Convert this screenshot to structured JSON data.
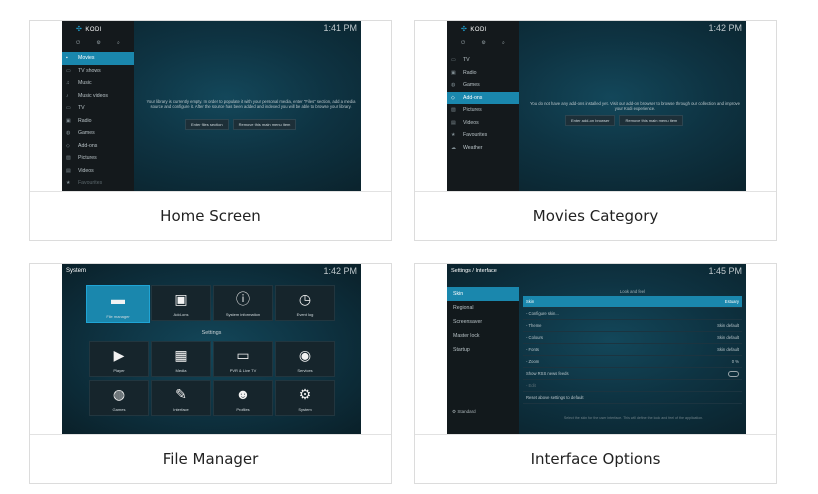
{
  "cards": [
    {
      "caption": "Home Screen",
      "clock": "1:41 PM",
      "logo": "KODI",
      "menu": [
        "Movies",
        "TV shows",
        "Music",
        "Music videos",
        "TV",
        "Radio",
        "Games",
        "Add-ons",
        "Pictures",
        "Videos",
        "Favourites"
      ],
      "message": "Your library is currently empty. In order to populate it with your personal media, enter \"Files\" section, add a media source and configure it. After the source has been added and indexed you will be able to browse your library.",
      "buttons": [
        "Enter files section",
        "Remove this main menu item"
      ]
    },
    {
      "caption": "Movies Category",
      "clock": "1:42 PM",
      "logo": "KODI",
      "menu": [
        "TV",
        "Radio",
        "Games",
        "Add-ons",
        "Pictures",
        "Videos",
        "Favourites",
        "Weather"
      ],
      "message": "You do not have any add-ons installed yet. Visit our add-on browser to browse through our collection and improve your Kodi experience.",
      "buttons": [
        "Enter add-on browser",
        "Remove this main menu item"
      ]
    },
    {
      "caption": "File Manager",
      "clock": "1:42 PM",
      "title": "System",
      "top_tiles": [
        "File manager",
        "Add-ons",
        "System information",
        "Event log"
      ],
      "settings_heading": "Settings",
      "settings_tiles": [
        "Player",
        "Media",
        "PVR & Live TV",
        "Services",
        "Games",
        "Interface",
        "Profiles",
        "System"
      ]
    },
    {
      "caption": "Interface Options",
      "clock": "1:45 PM",
      "title": "Settings / Interface",
      "side_items": [
        "Skin",
        "Regional",
        "Screensaver",
        "Master lock",
        "Startup"
      ],
      "level": "Standard",
      "section": "Look and feel",
      "rows": [
        {
          "label": "Skin",
          "value": "Estuary"
        },
        {
          "label": "- Configure skin...",
          "value": ""
        },
        {
          "label": "- Theme",
          "value": "Skin default"
        },
        {
          "label": "- Colours",
          "value": "Skin default"
        },
        {
          "label": "- Fonts",
          "value": "Skin default"
        },
        {
          "label": "- Zoom",
          "value": "0 %"
        },
        {
          "label": "Show RSS news feeds",
          "value": ""
        },
        {
          "label": "- Edit",
          "value": ""
        },
        {
          "label": "Reset above settings to default",
          "value": ""
        }
      ],
      "footer": "Select the skin for the user interface. This will define the look and feel of the application."
    }
  ],
  "icons": {
    "menu": [
      "movie-icon",
      "tv-icon",
      "music-icon",
      "music-video-icon",
      "tv-icon",
      "radio-icon",
      "gamepad-icon",
      "addons-icon",
      "pictures-icon",
      "videos-icon",
      "star-icon",
      "weather-icon"
    ],
    "system_tiles": [
      "folder-icon",
      "box-icon",
      "info-icon",
      "clock-icon"
    ],
    "settings_tiles": [
      "player-icon",
      "media-icon",
      "tv-icon",
      "podcast-icon",
      "gamepad-icon",
      "tools-icon",
      "user-icon",
      "gear-icon"
    ]
  },
  "colors": {
    "kodi_blue": "#1a87ad",
    "kodi_bg": "#0e3342"
  }
}
